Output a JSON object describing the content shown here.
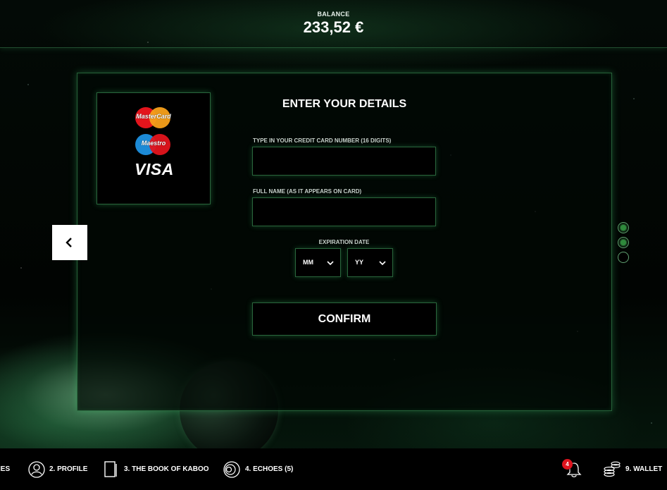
{
  "header": {
    "balance_label": "BALANCE",
    "balance_value": "233,52 €"
  },
  "payment_logos": {
    "mastercard": "MasterCard",
    "maestro": "Maestro",
    "visa": "VISA"
  },
  "form": {
    "title": "ENTER YOUR DETAILS",
    "card_number_label": "TYPE IN YOUR CREDIT CARD NUMBER (16 DIGITS)",
    "card_number_value": "",
    "full_name_label": "FULL NAME (AS IT APPEARS ON CARD)",
    "full_name_value": "",
    "expiration_label": "EXPIRATION DATE",
    "month_selected": "MM",
    "year_selected": "YY",
    "confirm_label": "CONFIRM"
  },
  "pager": {
    "dots": [
      "active",
      "active",
      "inactive"
    ]
  },
  "navbar": {
    "item_partial": "IES",
    "item_profile": "2. PROFILE",
    "item_book": "3. THE BOOK OF KABOO",
    "item_echoes": "4. ECHOES (5)",
    "notifications_count": "4",
    "item_wallet": "9. WALLET"
  },
  "colors": {
    "accent_glow": "#46aa64",
    "badge": "#e0141e",
    "mastercard_red": "#e3141c",
    "mastercard_orange": "#f7a01a",
    "maestro_blue": "#1c8ad6"
  }
}
